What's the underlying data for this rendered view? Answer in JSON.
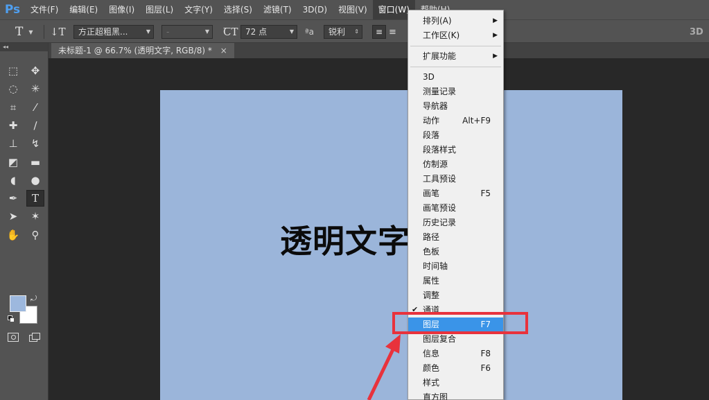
{
  "app": {
    "logo": "Ps"
  },
  "menubar": {
    "items": [
      "文件(F)",
      "编辑(E)",
      "图像(I)",
      "图层(L)",
      "文字(Y)",
      "选择(S)",
      "滤镜(T)",
      "3D(D)",
      "视图(V)",
      "窗口(W)",
      "帮助(H)"
    ],
    "active": "窗口(W)"
  },
  "options": {
    "tool_glyph": "T",
    "font_family": "方正超粗黑...",
    "font_style": "-",
    "font_size": "72 点",
    "aa_label": "ªa",
    "aa_mode": "锐利",
    "threed_label": "3D"
  },
  "document_tab": {
    "title": "未标题-1 @ 66.7% (透明文字, RGB/8) *",
    "close": "×"
  },
  "toolbar": {
    "collapse_glyph": "◂◂",
    "tools": [
      "marquee-icon",
      "move-icon",
      "lasso-icon",
      "magic-wand-icon",
      "crop-icon",
      "eyedropper-icon",
      "healing-brush-icon",
      "brush-icon",
      "clone-stamp-icon",
      "history-brush-icon",
      "eraser-icon",
      "gradient-icon",
      "blur-icon",
      "dodge-icon",
      "pen-icon",
      "type-icon",
      "path-select-icon",
      "shape-icon",
      "hand-icon",
      "zoom-icon"
    ],
    "selected_tool": "type-icon",
    "foreground_color": "#9db8de",
    "background_color": "#ffffff"
  },
  "canvas": {
    "text": "透明文字",
    "background_color": "#9bb5da"
  },
  "window_menu": {
    "items": [
      {
        "label": "排列(A)",
        "submenu": true
      },
      {
        "label": "工作区(K)",
        "submenu": true
      },
      {
        "separator": true
      },
      {
        "label": "扩展功能",
        "submenu": true
      },
      {
        "separator": true
      },
      {
        "label": "3D"
      },
      {
        "label": "测量记录"
      },
      {
        "label": "导航器"
      },
      {
        "label": "动作",
        "shortcut": "Alt+F9"
      },
      {
        "label": "段落"
      },
      {
        "label": "段落样式"
      },
      {
        "label": "仿制源"
      },
      {
        "label": "工具预设"
      },
      {
        "label": "画笔",
        "shortcut": "F5"
      },
      {
        "label": "画笔预设"
      },
      {
        "label": "历史记录"
      },
      {
        "label": "路径"
      },
      {
        "label": "色板"
      },
      {
        "label": "时间轴"
      },
      {
        "label": "属性"
      },
      {
        "label": "调整"
      },
      {
        "label": "通道",
        "checked": true
      },
      {
        "label": "图层",
        "shortcut": "F7",
        "highlighted": true
      },
      {
        "label": "图层复合"
      },
      {
        "label": "信息",
        "shortcut": "F8"
      },
      {
        "label": "颜色",
        "shortcut": "F6"
      },
      {
        "label": "样式"
      },
      {
        "label": "直方图"
      }
    ]
  },
  "annotation": {
    "highlight_color": "#e8323c"
  }
}
